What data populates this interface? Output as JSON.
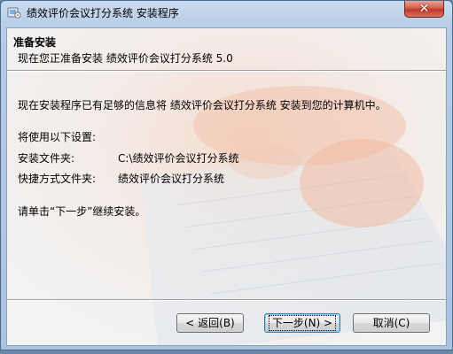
{
  "window": {
    "title": "绩效评价会议打分系统 安装程序",
    "close_glyph": "✕"
  },
  "header": {
    "title": "准备安装",
    "subtitle": "现在您正准备安装 绩效评价会议打分系统 5.0"
  },
  "body": {
    "intro": "现在安装程序已有足够的信息将 绩效评价会议打分系统 安装到您的计算机中。",
    "settings_heading": "将使用以下设置:",
    "install_folder_label": "安装文件夹:",
    "install_folder_value": "C:\\绩效评价会议打分系统",
    "shortcut_folder_label": "快捷方式文件夹:",
    "shortcut_folder_value": "绩效评价会议打分系统",
    "instruction": "请单击“下一步”继续安装。"
  },
  "buttons": {
    "back": "< 返回(B)",
    "next": "下一步(N) >",
    "cancel": "取消(C)"
  },
  "icons": {
    "app": "setup-app-icon",
    "close": "close-icon"
  },
  "colors": {
    "titlebar": "#b7cde6",
    "close_button": "#c0392b",
    "dialog_bg": "#f0f0f0"
  }
}
